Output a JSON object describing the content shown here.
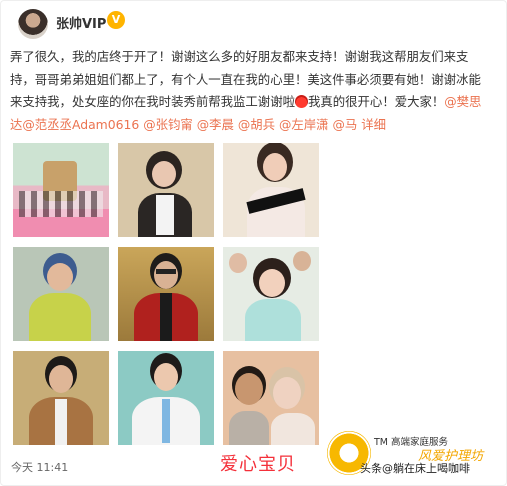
{
  "post": {
    "username": "张帅VIP",
    "text_segments": [
      "弄了很久，我的店终于开了！谢谢这么多的好朋友都来支持！谢谢我这帮朋友们来支持，哥哥弟弟姐姐们都上了，有个人一直在我的心里！美这件事必须要有她！谢谢冰能来支持我，处女座的你在我时装秀前帮我监工谢谢啦",
      "我真的很开心！爱大家！",
      "@樊思达",
      "@范丞丞Adam0616",
      "@张钧甯",
      "@李晨",
      "@胡兵",
      "@左岸潇",
      "@马 详细"
    ],
    "timestamp": "今天 11:41"
  },
  "photos": [
    {
      "desc": "event-wide",
      "bg": "#d9a9b8"
    },
    {
      "desc": "woman-dark-hair",
      "bg": "#c9b08a"
    },
    {
      "desc": "woman-offshoulder",
      "bg": "#e7d6c3"
    },
    {
      "desc": "man-yellow-hoodie",
      "bg": "#9fb7a4"
    },
    {
      "desc": "man-red-jacket",
      "bg": "#b78f47"
    },
    {
      "desc": "woman-blue-dress",
      "bg": "#dfe6df"
    },
    {
      "desc": "man-casual",
      "bg": "#bda36c"
    },
    {
      "desc": "man-white-suit",
      "bg": "#8fc6c2"
    },
    {
      "desc": "couple-selfie",
      "bg": "#d5a587"
    }
  ],
  "watermark": {
    "center_text": "爱心宝贝",
    "brand_tm": "TM",
    "brand_name": "高端家庭服务",
    "brand_script": "风爱护理坊",
    "source": "头条@躺在床上喝咖啡"
  },
  "colors": {
    "mention": "#eb7350",
    "watermark_red": "#f4303a",
    "brand_gold": "#f7b800"
  }
}
